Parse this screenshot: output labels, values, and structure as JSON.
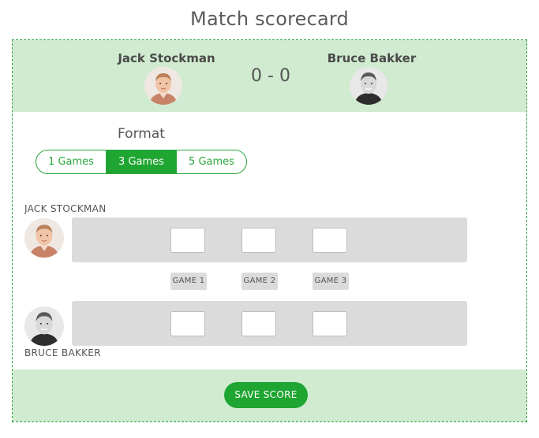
{
  "page": {
    "title": "Match scorecard"
  },
  "header": {
    "player1": {
      "name": "Jack Stockman"
    },
    "player2": {
      "name": "Bruce Bakker"
    },
    "score": "0 - 0"
  },
  "format": {
    "label": "Format",
    "options": [
      "1 Games",
      "3 Games",
      "5 Games"
    ],
    "selected": "3 Games"
  },
  "scoring": {
    "player1_label": "JACK STOCKMAN",
    "player2_label": "BRUCE BAKKER",
    "games": [
      "GAME 1",
      "GAME 2",
      "GAME 3"
    ],
    "player1_scores": [
      "",
      "",
      ""
    ],
    "player2_scores": [
      "",
      "",
      ""
    ]
  },
  "actions": {
    "save_label": "SAVE SCORE"
  },
  "colors": {
    "accent": "#1fa531",
    "band": "#d0ebcf",
    "track": "#dcdbdb"
  },
  "icons": {
    "player1_avatar": "avatar-photo",
    "player2_avatar": "avatar-photo"
  }
}
